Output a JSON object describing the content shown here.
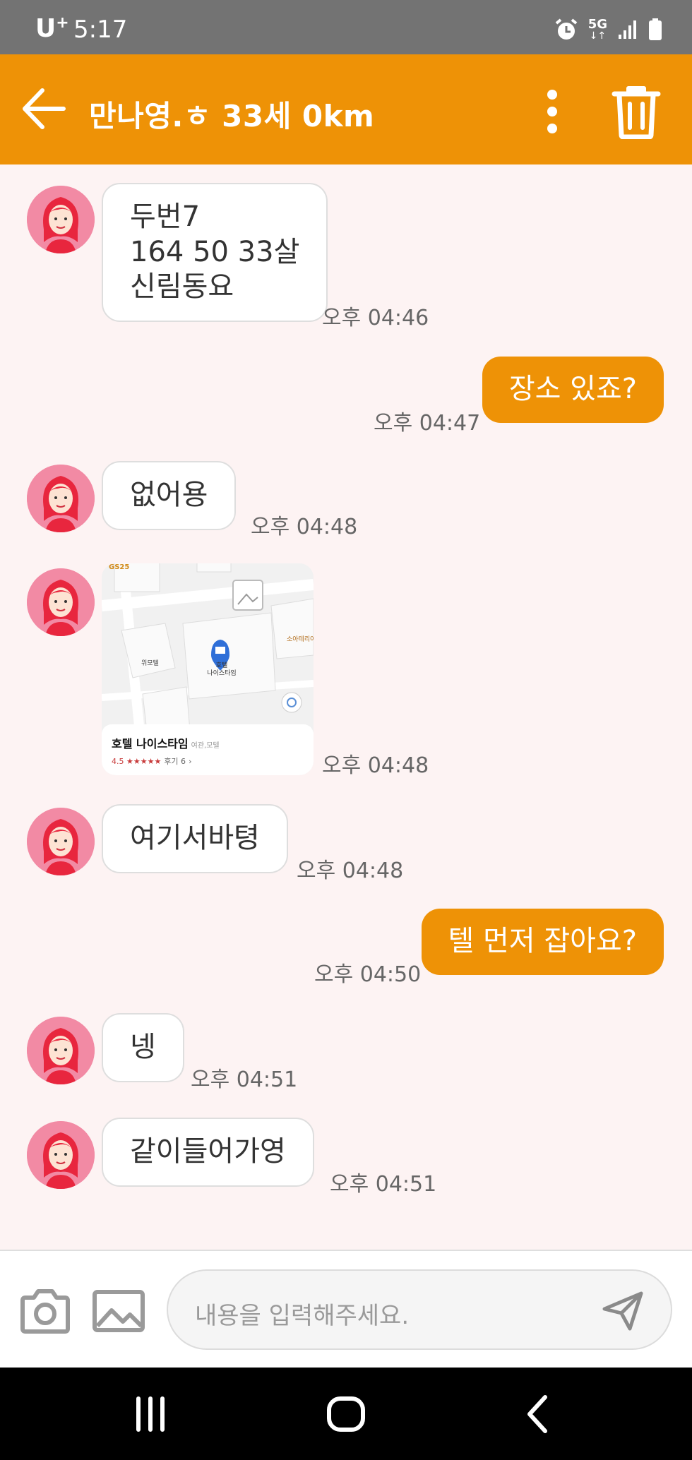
{
  "status_bar": {
    "carrier": "U",
    "carrier_plus": "+",
    "time": "5:17",
    "network": "5G"
  },
  "header": {
    "title": "만나영.ㅎ 33세 0km"
  },
  "messages": [
    {
      "sender": "other",
      "text": "두번7\n164 50 33살\n신림동요",
      "time": "오후 04:46"
    },
    {
      "sender": "me",
      "text": "장소 있죠?",
      "time": "오후 04:47"
    },
    {
      "sender": "other",
      "text": "없어용",
      "time": "오후 04:48"
    },
    {
      "sender": "other",
      "type": "map",
      "time": "오후 04:48",
      "map": {
        "place_name": "호텔 나이스타임",
        "category": "여관,모텔",
        "rating": "4.5",
        "stars": "★★★★★",
        "reviews": "후기 6",
        "pin_label": "호텔\n나이스타임",
        "poi_gs": "GS25",
        "poi_left": "위모텔",
        "poi_right": "소아테리아"
      }
    },
    {
      "sender": "other",
      "text": "여기서바텽",
      "time": "오후 04:48"
    },
    {
      "sender": "me",
      "text": "텔 먼저 잡아요?",
      "time": "오후 04:50"
    },
    {
      "sender": "other",
      "text": "넹",
      "time": "오후 04:51"
    },
    {
      "sender": "other",
      "text": "같이들어가영",
      "time": "오후 04:51"
    }
  ],
  "input": {
    "placeholder": "내용을 입력해주세요."
  },
  "colors": {
    "accent": "#ee9206",
    "background": "#fdf3f3",
    "status_bar": "#737373"
  }
}
